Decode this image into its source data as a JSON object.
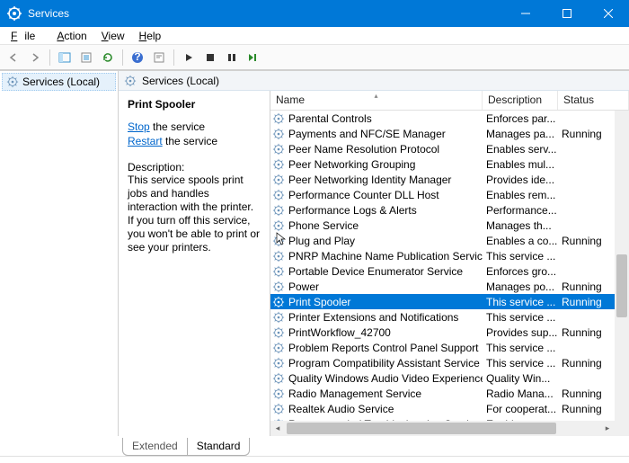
{
  "window": {
    "title": "Services"
  },
  "menu": {
    "file": "File",
    "action": "Action",
    "view": "View",
    "help": "Help"
  },
  "sidebar": {
    "label": "Services (Local)"
  },
  "main": {
    "header": "Services (Local)",
    "detail": {
      "title": "Print Spooler",
      "stop": "Stop",
      "stop_suffix": " the service",
      "restart": "Restart",
      "restart_suffix": " the service",
      "desc_label": "Description:",
      "desc": "This service spools print jobs and handles interaction with the printer. If you turn off this service, you won't be able to print or see your printers."
    },
    "columns": {
      "name": "Name",
      "desc": "Description",
      "status": "Status"
    },
    "services": [
      {
        "name": "Parental Controls",
        "desc": "Enforces par...",
        "status": ""
      },
      {
        "name": "Payments and NFC/SE Manager",
        "desc": "Manages pa...",
        "status": "Running"
      },
      {
        "name": "Peer Name Resolution Protocol",
        "desc": "Enables serv...",
        "status": ""
      },
      {
        "name": "Peer Networking Grouping",
        "desc": "Enables mul...",
        "status": ""
      },
      {
        "name": "Peer Networking Identity Manager",
        "desc": "Provides ide...",
        "status": ""
      },
      {
        "name": "Performance Counter DLL Host",
        "desc": "Enables rem...",
        "status": ""
      },
      {
        "name": "Performance Logs & Alerts",
        "desc": "Performance...",
        "status": ""
      },
      {
        "name": "Phone Service",
        "desc": "Manages th...",
        "status": ""
      },
      {
        "name": "Plug and Play",
        "desc": "Enables a co...",
        "status": "Running"
      },
      {
        "name": "PNRP Machine Name Publication Service",
        "desc": "This service ...",
        "status": ""
      },
      {
        "name": "Portable Device Enumerator Service",
        "desc": "Enforces gro...",
        "status": ""
      },
      {
        "name": "Power",
        "desc": "Manages po...",
        "status": "Running"
      },
      {
        "name": "Print Spooler",
        "desc": "This service ...",
        "status": "Running",
        "selected": true
      },
      {
        "name": "Printer Extensions and Notifications",
        "desc": "This service ...",
        "status": ""
      },
      {
        "name": "PrintWorkflow_42700",
        "desc": "Provides sup...",
        "status": "Running"
      },
      {
        "name": "Problem Reports Control Panel Support",
        "desc": "This service ...",
        "status": ""
      },
      {
        "name": "Program Compatibility Assistant Service",
        "desc": "This service ...",
        "status": "Running"
      },
      {
        "name": "Quality Windows Audio Video Experience",
        "desc": "Quality Win...",
        "status": ""
      },
      {
        "name": "Radio Management Service",
        "desc": "Radio Mana...",
        "status": "Running"
      },
      {
        "name": "Realtek Audio Service",
        "desc": "For cooperat...",
        "status": "Running"
      },
      {
        "name": "Recommended Troubleshooting Service",
        "desc": "Enables aut...",
        "status": ""
      }
    ]
  },
  "tabs": {
    "extended": "Extended",
    "standard": "Standard"
  }
}
